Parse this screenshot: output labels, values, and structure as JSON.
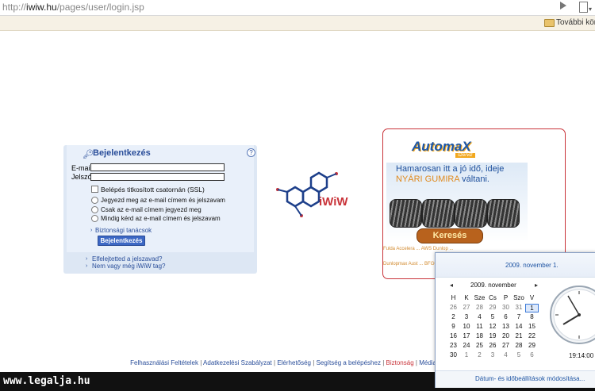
{
  "browser": {
    "url_prefix": "http://",
    "url_host": "iwiw.hu",
    "url_path": "/pages/user/login.jsp",
    "bookmarks_more": "További köny"
  },
  "login": {
    "title": "Bejelentkezés",
    "help": "?",
    "email_label": "E-mail:",
    "password_label": "Jelszó:",
    "email_value": "",
    "password_value": "",
    "ssl_option": "Belépés titkosított csatornán (SSL)",
    "remember_options": [
      "Jegyezd meg az e-mail címem és jelszavam",
      "Csak az e-mail címem jegyezd meg",
      "Mindig kérd az e-mail címem és jelszavam"
    ],
    "security_tips": "Biztonsági tanácsok",
    "submit_label": "Bejelentkezés",
    "forgot_password": "Elfelejtetted a jelszavad?",
    "not_member": "Nem vagy még iWiW tag?"
  },
  "logo": {
    "text": "iWiW",
    "accent": "#c9343a",
    "primary": "#1d3f8a"
  },
  "ad": {
    "brand": "AutomaX",
    "brand_sub": "szerviz",
    "line1": "Hamarosan itt a jó idő, ideje",
    "line2_highlight": "NYÁRI GUMIRA",
    "line2_rest": " váltani.",
    "search_button": "Keresés",
    "brands_row1": "Fulda  Accelera  ...  AWS  Dunlop  ...",
    "brands_row2": "Dunlopmax  Aust  ...  BFGOODRICH  ..."
  },
  "footer": {
    "links": [
      "Felhasználási Feltételek",
      "Adatkezelési Szabályzat",
      "Elérhetőség",
      "Segítség a belépéshez",
      "Biztonság",
      "Média"
    ]
  },
  "watermark": "www.legalja.hu",
  "calendar": {
    "long_date": "2009. november 1.",
    "month_label": "2009. november",
    "prev": "◂",
    "next": "▸",
    "weekday_headers": [
      "H",
      "K",
      "Sze",
      "Cs",
      "P",
      "Szo",
      "V"
    ],
    "weeks": [
      [
        "26",
        "27",
        "28",
        "29",
        "30",
        "31",
        "1"
      ],
      [
        "2",
        "3",
        "4",
        "5",
        "6",
        "7",
        "8"
      ],
      [
        "9",
        "10",
        "11",
        "12",
        "13",
        "14",
        "15"
      ],
      [
        "16",
        "17",
        "18",
        "19",
        "20",
        "21",
        "22"
      ],
      [
        "23",
        "24",
        "25",
        "26",
        "27",
        "28",
        "29"
      ],
      [
        "30",
        "1",
        "2",
        "3",
        "4",
        "5",
        "6"
      ]
    ],
    "today": "1",
    "time": "19:14:00",
    "settings_link": "Dátum- és időbeállítások módosítása..."
  }
}
